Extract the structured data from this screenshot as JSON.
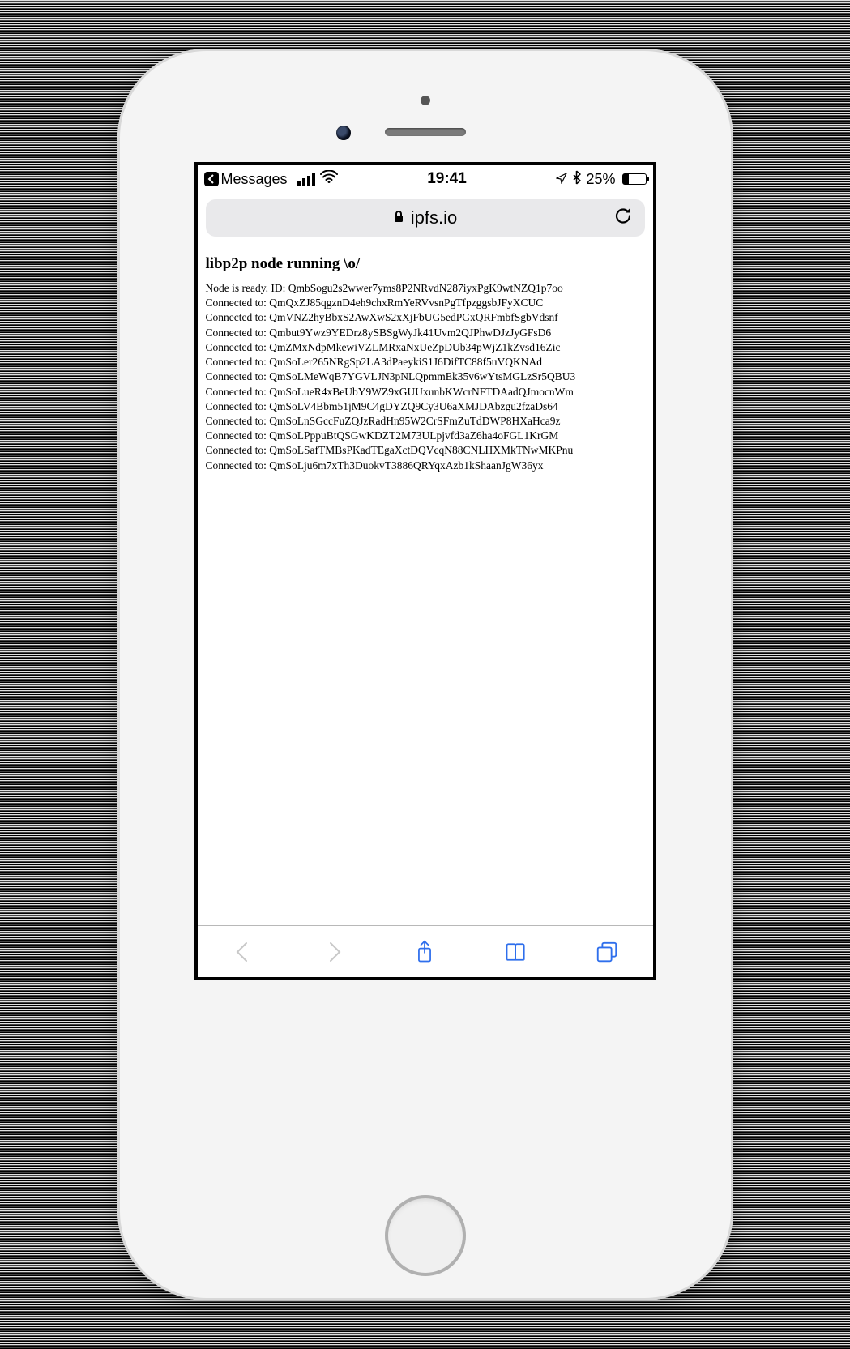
{
  "status": {
    "back_app_label": "Messages",
    "time": "19:41",
    "battery_pct": "25%"
  },
  "urlbar": {
    "domain": "ipfs.io"
  },
  "page": {
    "heading": "libp2p node running \\o/",
    "ready_prefix": "Node is ready. ID: ",
    "node_id": "QmbSogu2s2wwer7yms8P2NRvdN287iyxPgK9wtNZQ1p7oo",
    "connected_prefix": "Connected to: ",
    "peers": [
      "QmQxZJ85qgznD4eh9chxRmYeRVvsnPgTfpzggsbJFyXCUC",
      "QmVNZ2hyBbxS2AwXwS2xXjFbUG5edPGxQRFmbfSgbVdsnf",
      "Qmbut9Ywz9YEDrz8ySBSgWyJk41Uvm2QJPhwDJzJyGFsD6",
      "QmZMxNdpMkewiVZLMRxaNxUeZpDUb34pWjZ1kZvsd16Zic",
      "QmSoLer265NRgSp2LA3dPaeykiS1J6DifTC88f5uVQKNAd",
      "QmSoLMeWqB7YGVLJN3pNLQpmmEk35v6wYtsMGLzSr5QBU3",
      "QmSoLueR4xBeUbY9WZ9xGUUxunbKWcrNFTDAadQJmocnWm",
      "QmSoLV4Bbm51jM9C4gDYZQ9Cy3U6aXMJDAbzgu2fzaDs64",
      "QmSoLnSGccFuZQJzRadHn95W2CrSFmZuTdDWP8HXaHca9z",
      "QmSoLPppuBtQSGwKDZT2M73ULpjvfd3aZ6ha4oFGL1KrGM",
      "QmSoLSafTMBsPKadTEgaXctDQVcqN88CNLHXMkTNwMKPnu",
      "QmSoLju6m7xTh3DuokvT3886QRYqxAzb1kShaanJgW36yx"
    ]
  }
}
